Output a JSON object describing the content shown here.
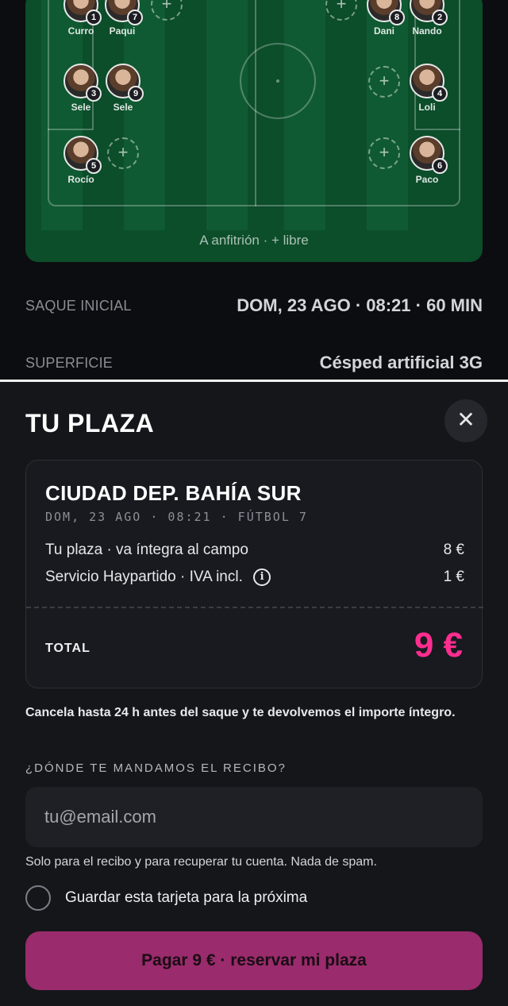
{
  "pitch": {
    "players": [
      {
        "name": "Curro",
        "number": "1"
      },
      {
        "name": "Paqui",
        "number": "7"
      },
      {
        "name": "Dani",
        "number": "8"
      },
      {
        "name": "Nando",
        "number": "2"
      },
      {
        "name": "Sele",
        "number": "3"
      },
      {
        "name": "Sele",
        "number": "9"
      },
      {
        "name": "Loli",
        "number": "4"
      },
      {
        "name": "Rocío",
        "number": "5"
      },
      {
        "name": "Paco",
        "number": "6"
      }
    ],
    "open_slot_symbol": "+",
    "caption": "A anfitrión · + libre"
  },
  "details": {
    "kickoff_label": "SAQUE INICIAL",
    "kickoff_value": "DOM, 23 AGO · 08:21 · 60 MIN",
    "surface_label": "SUPERFICIE",
    "surface_value": "Césped artificial 3G"
  },
  "sheet": {
    "title": "TU PLAZA",
    "close_symbol": "✕",
    "venue": "CIUDAD DEP. BAHÍA SUR",
    "meta": "DOM, 23 AGO · 08:21 · FÚTBOL 7",
    "line_items": [
      {
        "label": "Tu plaza · va íntegra al campo",
        "amount": "8 €"
      },
      {
        "label": "Servicio Haypartido · IVA incl.",
        "amount": "1 €",
        "info": "i"
      }
    ],
    "total_label": "TOTAL",
    "total_value": "9 €",
    "cancel_note": "Cancela hasta 24 h antes del saque y te devolvemos el importe íntegro.",
    "receipt_label": "¿DÓNDE TE MANDAMOS EL RECIBO?",
    "email_placeholder": "tu@email.com",
    "spam_note": "Solo para el recibo y para recuperar tu cuenta. Nada de spam.",
    "save_card_label": "Guardar esta tarjeta para la próxima",
    "pay_button": "Pagar 9 € · reservar mi plaza"
  },
  "colors": {
    "accent_total": "#ff2d8f",
    "pay_button": "#9a2b6c",
    "pitch": "#0c4d2a"
  }
}
